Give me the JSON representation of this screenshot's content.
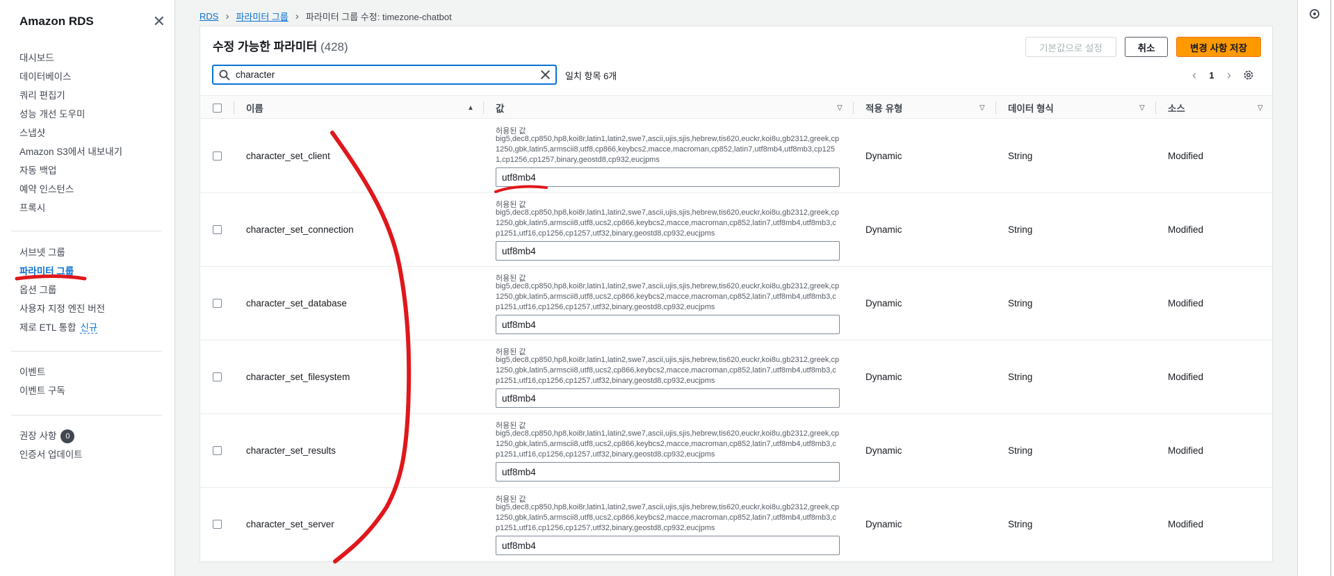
{
  "sidebar": {
    "title": "Amazon RDS",
    "group1": [
      "대시보드",
      "데이터베이스",
      "쿼리 편집기",
      "성능 개선 도우미",
      "스냅샷",
      "Amazon S3에서 내보내기",
      "자동 백업",
      "예약 인스턴스",
      "프록시"
    ],
    "group2": [
      "서브넷 그룹",
      "파라미터 그룹",
      "옵션 그룹",
      "사용자 지정 엔진 버전"
    ],
    "zero_etl_label": "제로 ETL 통합",
    "new_badge": "신규",
    "group3": [
      "이벤트",
      "이벤트 구독"
    ],
    "recommendations_label": "권장 사항",
    "recommendations_count": "0",
    "cert_update_label": "인증서 업데이트"
  },
  "breadcrumb": {
    "root": "RDS",
    "parent": "파라미터 그룹",
    "current": "파라미터 그룹 수정: timezone-chatbot"
  },
  "panel": {
    "title": "수정 가능한 파라미터",
    "count": "(428)",
    "reset_label": "기본값으로 설정",
    "cancel_label": "취소",
    "save_label": "변경 사항 저장",
    "search_value": "character",
    "match_text": "일치 항목 6개",
    "page": "1"
  },
  "columns": {
    "name": "이름",
    "value": "값",
    "apply_type": "적용 유형",
    "data_type": "데이터 형식",
    "source": "소스"
  },
  "rows": [
    {
      "name": "character_set_client",
      "allowed_label": "허용된 값",
      "allowed": "big5,dec8,cp850,hp8,koi8r,latin1,latin2,swe7,ascii,ujis,sjis,hebrew,tis620,euckr,koi8u,gb2312,greek,cp1250,gbk,latin5,armscii8,utf8,cp866,keybcs2,macce,macroman,cp852,latin7,utf8mb4,utf8mb3,cp1251,cp1256,cp1257,binary,geostd8,cp932,eucjpms",
      "value": "utf8mb4",
      "apply_type": "Dynamic",
      "data_type": "String",
      "source": "Modified"
    },
    {
      "name": "character_set_connection",
      "allowed_label": "허용된 값",
      "allowed": "big5,dec8,cp850,hp8,koi8r,latin1,latin2,swe7,ascii,ujis,sjis,hebrew,tis620,euckr,koi8u,gb2312,greek,cp1250,gbk,latin5,armscii8,utf8,ucs2,cp866,keybcs2,macce,macroman,cp852,latin7,utf8mb4,utf8mb3,cp1251,utf16,cp1256,cp1257,utf32,binary,geostd8,cp932,eucjpms",
      "value": "utf8mb4",
      "apply_type": "Dynamic",
      "data_type": "String",
      "source": "Modified"
    },
    {
      "name": "character_set_database",
      "allowed_label": "허용된 값",
      "allowed": "big5,dec8,cp850,hp8,koi8r,latin1,latin2,swe7,ascii,ujis,sjis,hebrew,tis620,euckr,koi8u,gb2312,greek,cp1250,gbk,latin5,armscii8,utf8,ucs2,cp866,keybcs2,macce,macroman,cp852,latin7,utf8mb4,utf8mb3,cp1251,utf16,cp1256,cp1257,utf32,binary,geostd8,cp932,eucjpms",
      "value": "utf8mb4",
      "apply_type": "Dynamic",
      "data_type": "String",
      "source": "Modified"
    },
    {
      "name": "character_set_filesystem",
      "allowed_label": "허용된 값",
      "allowed": "big5,dec8,cp850,hp8,koi8r,latin1,latin2,swe7,ascii,ujis,sjis,hebrew,tis620,euckr,koi8u,gb2312,greek,cp1250,gbk,latin5,armscii8,utf8,ucs2,cp866,keybcs2,macce,macroman,cp852,latin7,utf8mb4,utf8mb3,cp1251,utf16,cp1256,cp1257,utf32,binary,geostd8,cp932,eucjpms",
      "value": "utf8mb4",
      "apply_type": "Dynamic",
      "data_type": "String",
      "source": "Modified"
    },
    {
      "name": "character_set_results",
      "allowed_label": "허용된 값",
      "allowed": "big5,dec8,cp850,hp8,koi8r,latin1,latin2,swe7,ascii,ujis,sjis,hebrew,tis620,euckr,koi8u,gb2312,greek,cp1250,gbk,latin5,armscii8,utf8,ucs2,cp866,keybcs2,macce,macroman,cp852,latin7,utf8mb4,utf8mb3,cp1251,utf16,cp1256,cp1257,utf32,binary,geostd8,cp932,eucjpms",
      "value": "utf8mb4",
      "apply_type": "Dynamic",
      "data_type": "String",
      "source": "Modified"
    },
    {
      "name": "character_set_server",
      "allowed_label": "허용된 값",
      "allowed": "big5,dec8,cp850,hp8,koi8r,latin1,latin2,swe7,ascii,ujis,sjis,hebrew,tis620,euckr,koi8u,gb2312,greek,cp1250,gbk,latin5,armscii8,utf8,ucs2,cp866,keybcs2,macce,macroman,cp852,latin7,utf8mb4,utf8mb3,cp1251,utf16,cp1256,cp1257,utf32,binary,geostd8,cp932,eucjpms",
      "value": "utf8mb4",
      "apply_type": "Dynamic",
      "data_type": "String",
      "source": "Modified"
    }
  ],
  "icons": {
    "close": "close-icon",
    "search": "search-icon",
    "clear": "clear-icon",
    "gear": "gear-icon",
    "prev": "chevron-left-icon",
    "next": "chevron-right-icon",
    "rail": "status-icon"
  },
  "colors": {
    "primary": "#ff9900",
    "link": "#0972d3",
    "annotation": "#e0171b"
  }
}
